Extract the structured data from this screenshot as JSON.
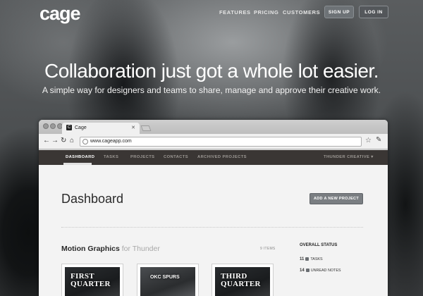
{
  "header": {
    "logo": "cage",
    "nav": [
      "FEATURES",
      "PRICING",
      "CUSTOMERS"
    ],
    "signup_label": "SIGN UP",
    "login_label": "LOG IN"
  },
  "hero": {
    "headline": "Collaboration just got a whole lot easier.",
    "subheadline": "A simple way for designers and teams to share, manage and approve their creative work."
  },
  "browser": {
    "tab_title": "Cage",
    "favicon": "C",
    "url": "www.cageapp.com"
  },
  "app": {
    "nav": [
      "DASHBOARD",
      "TASKS",
      "PROJECTS",
      "CONTACTS",
      "ARCHIVED PROJECTS"
    ],
    "account": "THUNDER CREATIVE",
    "page_title": "Dashboard",
    "add_project_label": "ADD A NEW PROJECT",
    "project": {
      "title": "Motion Graphics",
      "client": "for Thunder",
      "items": "9 ITEMS"
    },
    "status": {
      "heading": "OVERALL STATUS",
      "tasks_count": "11",
      "tasks_label": "TASKS",
      "notes_count": "14",
      "notes_label": "UNREAD NOTES"
    },
    "thumbnails": [
      {
        "caption": "FIRST QUARTER"
      },
      {
        "caption": "OKC SPURS"
      },
      {
        "caption": "THIRD QUARTER"
      }
    ]
  }
}
